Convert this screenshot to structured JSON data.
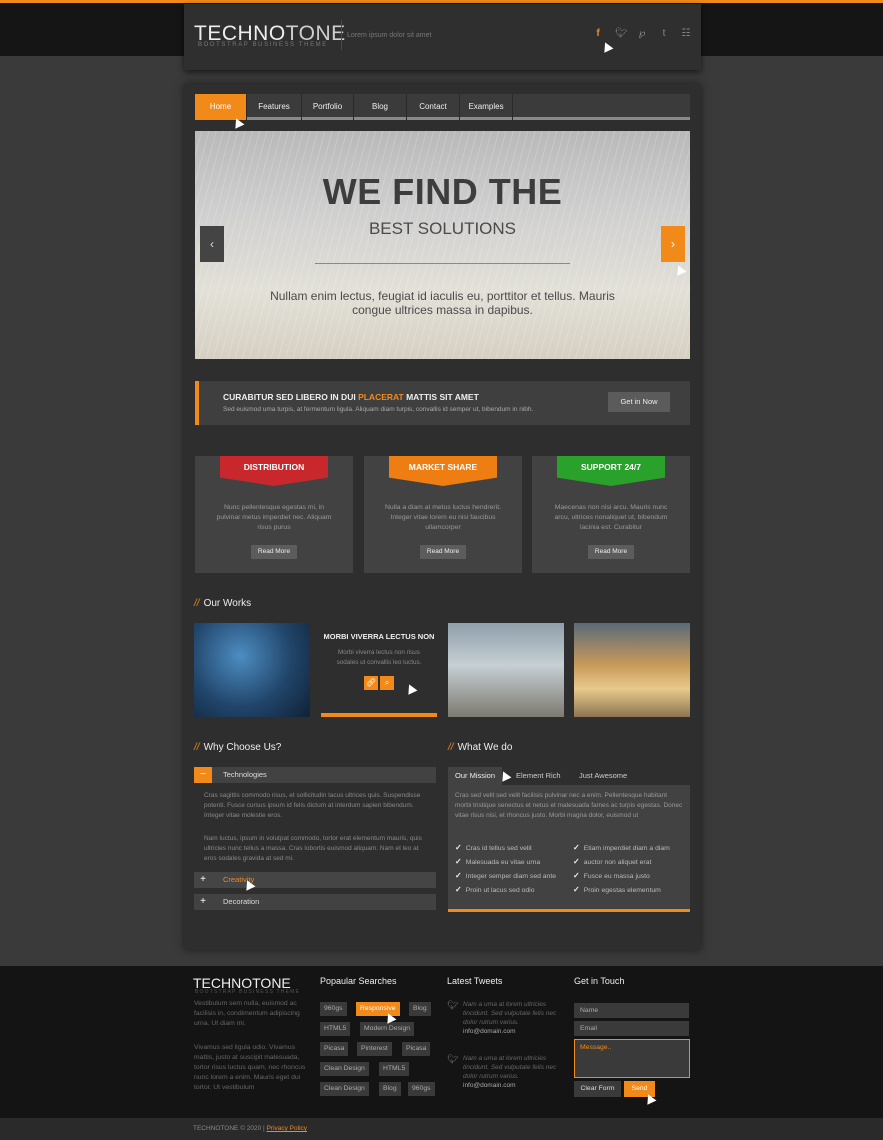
{
  "header": {
    "logo_a": "TECHNO",
    "logo_b": "TONE",
    "logo_sub": "BOOTSTRAP BUSINESS THEME",
    "tagline": "Lorem ipsum dolor sit amet",
    "social": [
      "f",
      "twitter-icon",
      "pinterest-icon",
      "t",
      "rss-icon"
    ]
  },
  "nav": [
    "Home",
    "Features",
    "Portfolio",
    "Blog",
    "Contact",
    "Examples"
  ],
  "slider": {
    "title": "WE FIND THE",
    "subtitle": "BEST SOLUTIONS",
    "text": "Nullam enim lectus, feugiat id iaculis eu, porttitor et tellus. Mauris congue ultrices massa in dapibus."
  },
  "cta": {
    "title_pre": "CURABITUR SED LIBERO IN DUI ",
    "title_hl": "PLACERAT",
    "title_post": " MATTIS SIT AMET",
    "text": "Sed euismod uma turpis, at fermentum ligula. Aliquam diam turpis, convallis id semper ut, bibendum in nibh.",
    "button": "Get in Now"
  },
  "features": [
    {
      "title": "DISTRIBUTION",
      "text": "Nunc pellentesque egestas mi, in pulvinar metus imperdiet nec. Aliquam risus purus",
      "button": "Read More"
    },
    {
      "title": "MARKET SHARE",
      "text": "Nulla a diam at metus luctus hendrerit. Integer vitae lorem eu nisi faucibus ullamcorper",
      "button": "Read More"
    },
    {
      "title": "SUPPORT 24/7",
      "text": "Maecenas non nisi arcu. Mauris nunc arcu, ultrices nonaliquet ut, bibendum lacinia est. Curabitur",
      "button": "Read More"
    }
  ],
  "works": {
    "heading": "Our Works",
    "item_title": "MORBI VIVERRA LECTUS NON",
    "item_text": "Morbi viverra lectus non risus sodales ut convallis leo luctus."
  },
  "why": {
    "heading": "Why Choose Us?",
    "items": [
      "Technologies",
      "Creativity",
      "Decoration"
    ],
    "para1": "Cras sagittis commodo risus, et sollicitudin lacus ultrices quis. Suspendisse potenti. Fusce cursus ipsum id felis dictum at interdum sapien bibendum. Integer vitae molestie eros.",
    "para2": "Nam luctus, ipsum in volutpat commodo, tortor erat elementum mauris, quis ultricies nunc tellus a massa. Cras lobortis euismod aliquam. Nam et leo at eros sodales gravida at sed mi."
  },
  "whatwedo": {
    "heading": "What We do",
    "tabs": [
      "Our Mission",
      "Element Rich",
      "Just Awesome"
    ],
    "text": "Cras sed velit sed velit facilisis pulvinar nec a enim. Pellentesque habitant morbi tristique senectus et netus et malesuada fames ac turpis egestas. Donec vitae risus nisi, et rhoncus justo. Morbi magna dolor, euismod ut",
    "list_left": [
      "Cras id tellus sed velit",
      "Malesuada eu vitae urna",
      "Integer semper diam sed ante",
      "Proin ut lacus sed odio"
    ],
    "list_right": [
      "Etiam imperdiet diam a diam",
      "auctor non aliquet erat",
      "Fusce eu massa justo",
      "Proin egestas elementum"
    ]
  },
  "footer": {
    "logo_a": "TECHNO",
    "logo_b": "TONE",
    "logo_sub": "BOOTSTRAP BUSINESS THEME",
    "about1": "Vestibulum sem nulla, euismod ac facilisis in, condimentum adipiscing urna. Ut diam mi.",
    "about2": "Vivamus sed ligula odio. Vivamus mattis, justo at suscipit malesuada, tortor risus luctus quam, nec rhoncus nunc lorem a enim. Mauris eget dui tortor. Ut vestibulum",
    "searches_heading": "Popaular Searches",
    "tags": [
      "960gs",
      "Responsive",
      "Blog",
      "HTML5",
      "Modern Design",
      "Picasa",
      "Pinterest",
      "Picasa",
      "Clean Design",
      "HTML5",
      "Clean Design",
      "Blog",
      "960gs"
    ],
    "tweets_heading": "Latest Tweets",
    "tweets": [
      {
        "text": "Nam a urna at lorem ultricies tincidunt. Sed vulputate felis nec dolor rutrum varius.",
        "by": "info@domain.com"
      },
      {
        "text": "Nam a urna at lorem ultricies tincidunt. Sed vulputate felis nec dolor rutrum varius.",
        "by": "info@domain.com"
      }
    ],
    "contact_heading": "Get in Touch",
    "name_placeholder": "Name",
    "email_placeholder": "Email",
    "message_placeholder": "Message..",
    "clear_button": "Clear Form",
    "send_button": "Send"
  },
  "bottom": {
    "copyright": "TECHNOTONE  ©  2020  |",
    "privacy": "Privacy Policy"
  },
  "colors": {
    "accent": "#f28a1a",
    "red": "#c8272b",
    "green": "#2aa12a"
  }
}
